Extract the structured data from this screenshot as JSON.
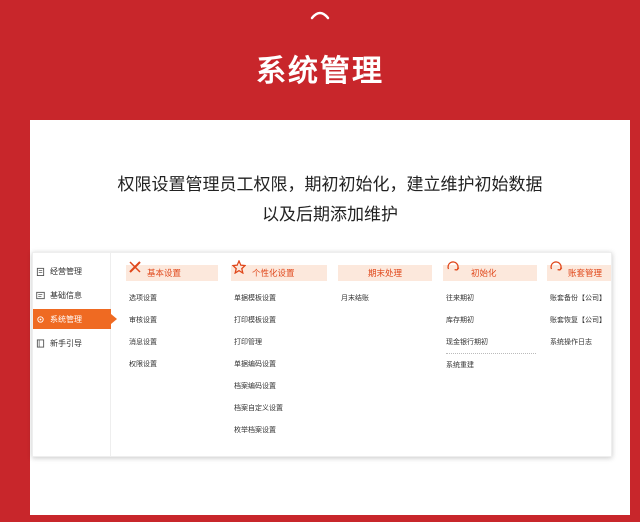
{
  "page": {
    "title": "系统管理",
    "desc_line1": "权限设置管理员工权限，期初初始化，建立维护初始数据",
    "desc_line2": "以及后期添加维护"
  },
  "sidebar": {
    "items": [
      {
        "label": "经营管理",
        "icon": "clipboard-icon"
      },
      {
        "label": "基础信息",
        "icon": "id-card-icon"
      },
      {
        "label": "系统管理",
        "icon": "gear-icon",
        "active": true
      },
      {
        "label": "新手引导",
        "icon": "book-icon"
      }
    ]
  },
  "columns": [
    {
      "title": "基本设置",
      "icon": "tools-icon",
      "items": [
        "选项设置",
        "审核设置",
        "消息设置",
        "权限设置"
      ]
    },
    {
      "title": "个性化设置",
      "icon": "star-icon",
      "items": [
        "单据模板设置",
        "打印模板设置",
        "打印管理",
        "单据编码设置",
        "档案编码设置",
        "档案自定义设置",
        "枚举档案设置"
      ]
    },
    {
      "title": "期末处理",
      "icon": "",
      "items": [
        "月末结账"
      ]
    },
    {
      "title": "初始化",
      "icon": "refresh-icon",
      "items": [
        "往来期初",
        "库存期初",
        "现金银行期初"
      ],
      "extra_item": "系统重建"
    },
    {
      "title": "账套管理",
      "icon": "refresh-icon",
      "items": [
        "账套备份【公司】",
        "账套恢复【公司】",
        "系统操作日志"
      ]
    }
  ],
  "colors": {
    "background": "#c8262b",
    "accent": "#ef6a22",
    "header_bg": "#fce8dc",
    "header_text": "#e0471a"
  }
}
